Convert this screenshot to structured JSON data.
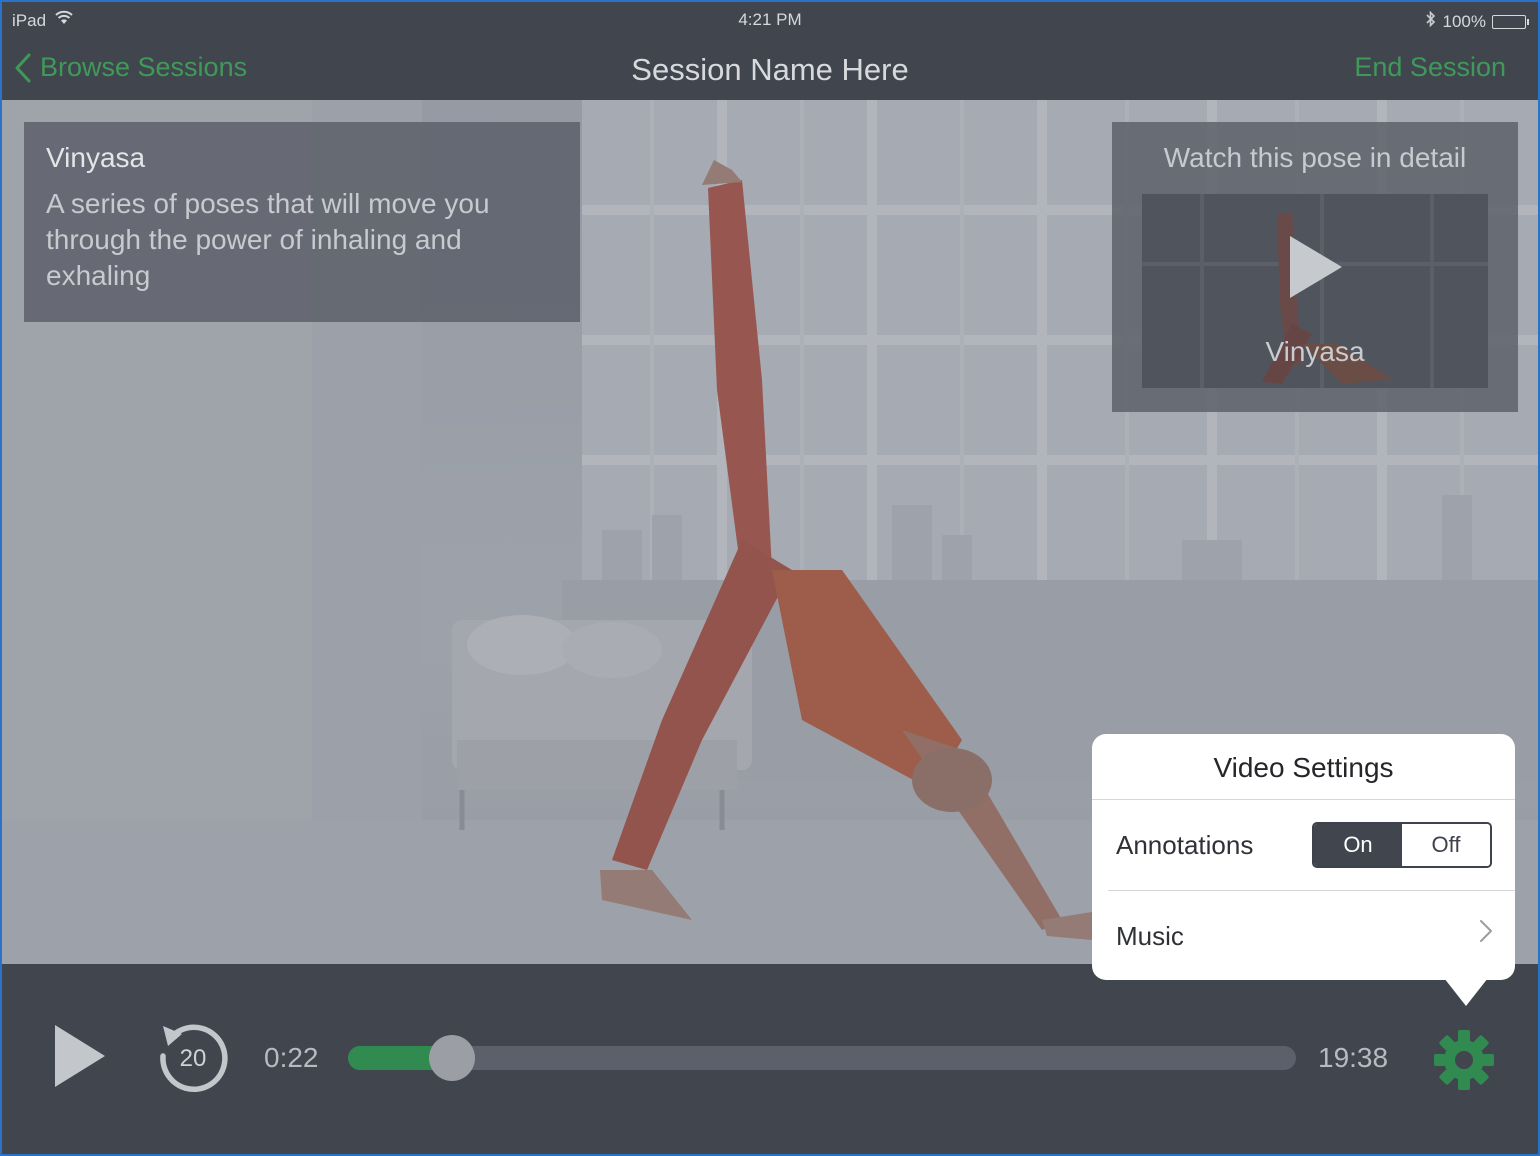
{
  "status_bar": {
    "device": "iPad",
    "time": "4:21 PM",
    "battery": "100%",
    "battery_level": 1.0
  },
  "nav": {
    "back_label": "Browse Sessions",
    "title": "Session Name Here",
    "end_label": "End Session",
    "accent_color": "#3f9a5a"
  },
  "info_card": {
    "title": "Vinyasa",
    "description": "A series of poses that will move you through the power of inhaling and exhaling"
  },
  "pose_card": {
    "title": "Watch this pose in detail",
    "thumbnail_label": "Vinyasa"
  },
  "player": {
    "rewind_seconds": "20",
    "elapsed": "0:22",
    "total": "19:38",
    "progress_fraction": 0.11,
    "progress_color": "#318a50"
  },
  "video_settings": {
    "title": "Video Settings",
    "annotations_label": "Annotations",
    "annotations_on": "On",
    "annotations_off": "Off",
    "annotations_selected": "On",
    "music_label": "Music"
  },
  "icons": {
    "back": "chevron-left-icon",
    "wifi": "wifi-icon",
    "bluetooth": "bluetooth-icon",
    "battery": "battery-icon",
    "play": "play-icon",
    "rewind": "rewind-20-icon",
    "settings": "gear-icon",
    "music_disclosure": "chevron-right-icon"
  }
}
